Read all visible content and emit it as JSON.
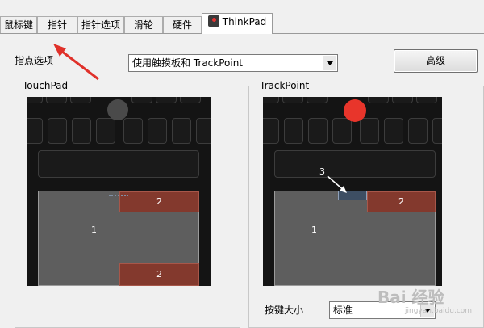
{
  "tabs": [
    {
      "label": "鼠标键"
    },
    {
      "label": "指针"
    },
    {
      "label": "指针选项"
    },
    {
      "label": "滑轮"
    },
    {
      "label": "硬件"
    },
    {
      "label": "ThinkPad",
      "active": true,
      "icon": "thinkpad-icon"
    }
  ],
  "pointing": {
    "label": "指点选项",
    "selected": "使用触摸板和 TrackPoint",
    "advanced_button": "高级"
  },
  "touchpad": {
    "title": "TouchPad",
    "zones": {
      "main": "1",
      "top_buttons": "2",
      "bottom_buttons": "2"
    }
  },
  "trackpoint": {
    "title": "TrackPoint",
    "zones": {
      "main": "1",
      "buttons": "2",
      "scroll_button": "3"
    }
  },
  "button_size": {
    "label": "按键大小",
    "selected": "标准"
  },
  "colors": {
    "trackpoint_dot": "#e8352b",
    "touchpad_dot": "#4a4a4a",
    "button_zone": "#83392d",
    "annotation_arrow": "#e0312a"
  },
  "watermark": {
    "text": "Bai 经验",
    "sub": "jingyan.baidu.com"
  }
}
